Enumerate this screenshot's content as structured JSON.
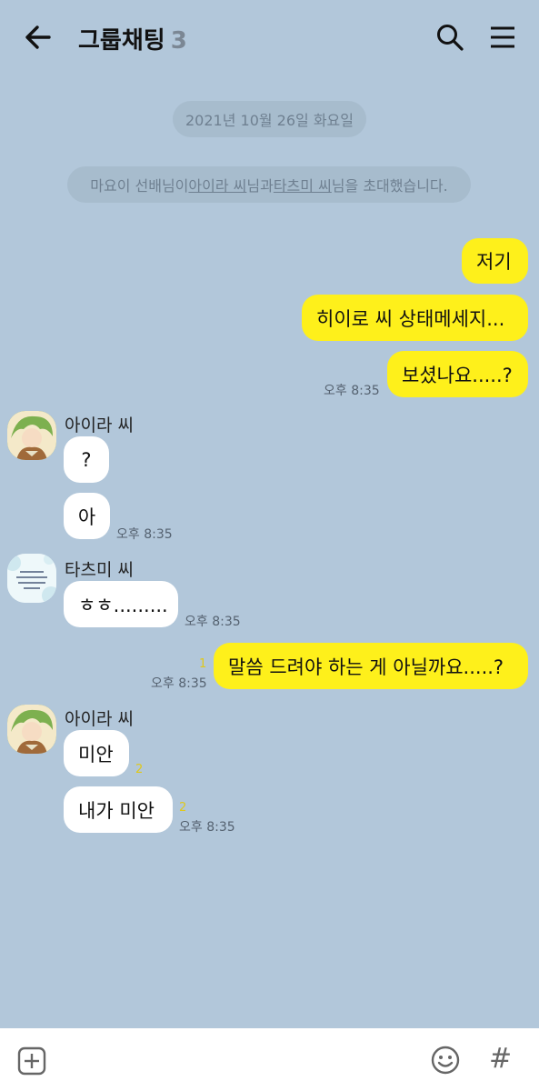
{
  "header": {
    "title": "그룹채팅",
    "member_count": "3"
  },
  "date_divider": "2021년 10월 26일 화요일",
  "system_message": {
    "prefix": "마요이 선배님이 ",
    "user1": "아이라 씨",
    "middle": "님과 ",
    "user2": "타츠미 씨",
    "suffix": "님을 초대했습니다."
  },
  "messages": [
    {
      "text": "저기"
    },
    {
      "text": "히이로 씨 상태메세지..."
    },
    {
      "text": "보셨나요.....?",
      "time": "오후 8:35"
    },
    {
      "sender": "아이라 씨",
      "text": "?"
    },
    {
      "text": "아",
      "time": "오후 8:35"
    },
    {
      "sender": "타츠미 씨",
      "text": "ㅎㅎ.........",
      "time": "오후 8:35"
    },
    {
      "text": "말씀 드려야 하는 게 아닐까요.....?",
      "time": "오후 8:35",
      "unread": "1"
    },
    {
      "sender": "아이라 씨",
      "text": "미안",
      "unread": "2"
    },
    {
      "text": "내가 미안",
      "time": "오후 8:35",
      "unread": "2"
    }
  ],
  "icons": {
    "back": "arrow-left-icon",
    "search": "search-icon",
    "menu": "hamburger-menu-icon",
    "add": "plus-square-icon",
    "emoji": "smiley-icon",
    "hash": "hash-icon"
  },
  "footer": {
    "hash_glyph": "#"
  },
  "colors": {
    "background": "#b2c7da",
    "my_bubble": "#fef01b",
    "their_bubble": "#ffffff"
  }
}
